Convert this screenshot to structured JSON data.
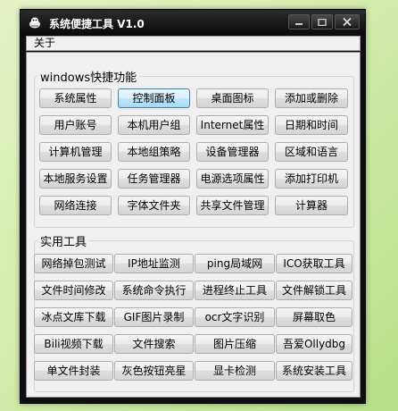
{
  "window": {
    "title": "系统便捷工具 V1.0"
  },
  "menu": {
    "about": "关于"
  },
  "windows_group": {
    "title": "windows快捷功能",
    "active_button": "控制面板",
    "rows": [
      [
        "系统属性",
        "控制面板",
        "桌面图标",
        "添加或删除"
      ],
      [
        "用户账号",
        "本机用户组",
        "Internet属性",
        "日期和时间"
      ],
      [
        "计算机管理",
        "本地组策略",
        "设备管理器",
        "区域和语言"
      ],
      [
        "本地服务设置",
        "任务管理器",
        "电源选项属性",
        "添加打印机"
      ],
      [
        "网络连接",
        "字体文件夹",
        "共享文件管理",
        "计算器"
      ]
    ]
  },
  "tools_group": {
    "title": "实用工具",
    "rows": [
      [
        "网络掉包测试",
        "IP地址监测",
        "ping局域网",
        "ICO获取工具"
      ],
      [
        "文件时间修改",
        "系统命令执行",
        "进程终止工具",
        "文件解锁工具"
      ],
      [
        "冰点文库下载",
        "GIF图片录制",
        "ocr文字识别",
        "屏幕取色"
      ],
      [
        "Bili视频下载",
        "文件搜索",
        "图片压缩",
        "吾爱Ollydbg"
      ],
      [
        "单文件封装",
        "灰色按钮亮星",
        "显卡检测",
        "系统安装工具"
      ]
    ]
  }
}
